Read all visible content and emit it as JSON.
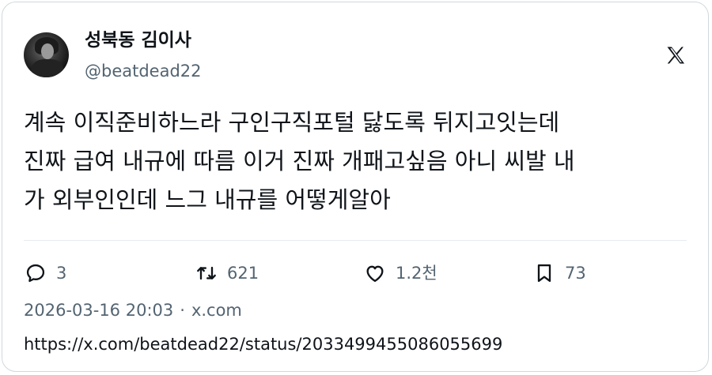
{
  "author": {
    "display_name": "성북동 김이사",
    "handle": "@beatdead22"
  },
  "brand_icon": "x-logo-icon",
  "tweet": {
    "lines": [
      "계속 이직준비하느라 구인구직포털 닳도록 뒤지고잇는데",
      "진짜 급여 내규에 따름 이거 진짜 개패고싶음 아니 씨발 내",
      "가 외부인인데 느그 내규를 어떻게알아"
    ]
  },
  "actions": {
    "replies": "3",
    "reposts": "621",
    "likes": "1.2천",
    "bookmarks": "73"
  },
  "meta": {
    "timestamp": "2026-03-16 20:03",
    "separator": "·",
    "source": "x.com"
  },
  "url": "https://x.com/beatdead22/status/2033499455086055699",
  "colors": {
    "text": "#0f1419",
    "secondary": "#536471",
    "border": "#cfd9de"
  }
}
